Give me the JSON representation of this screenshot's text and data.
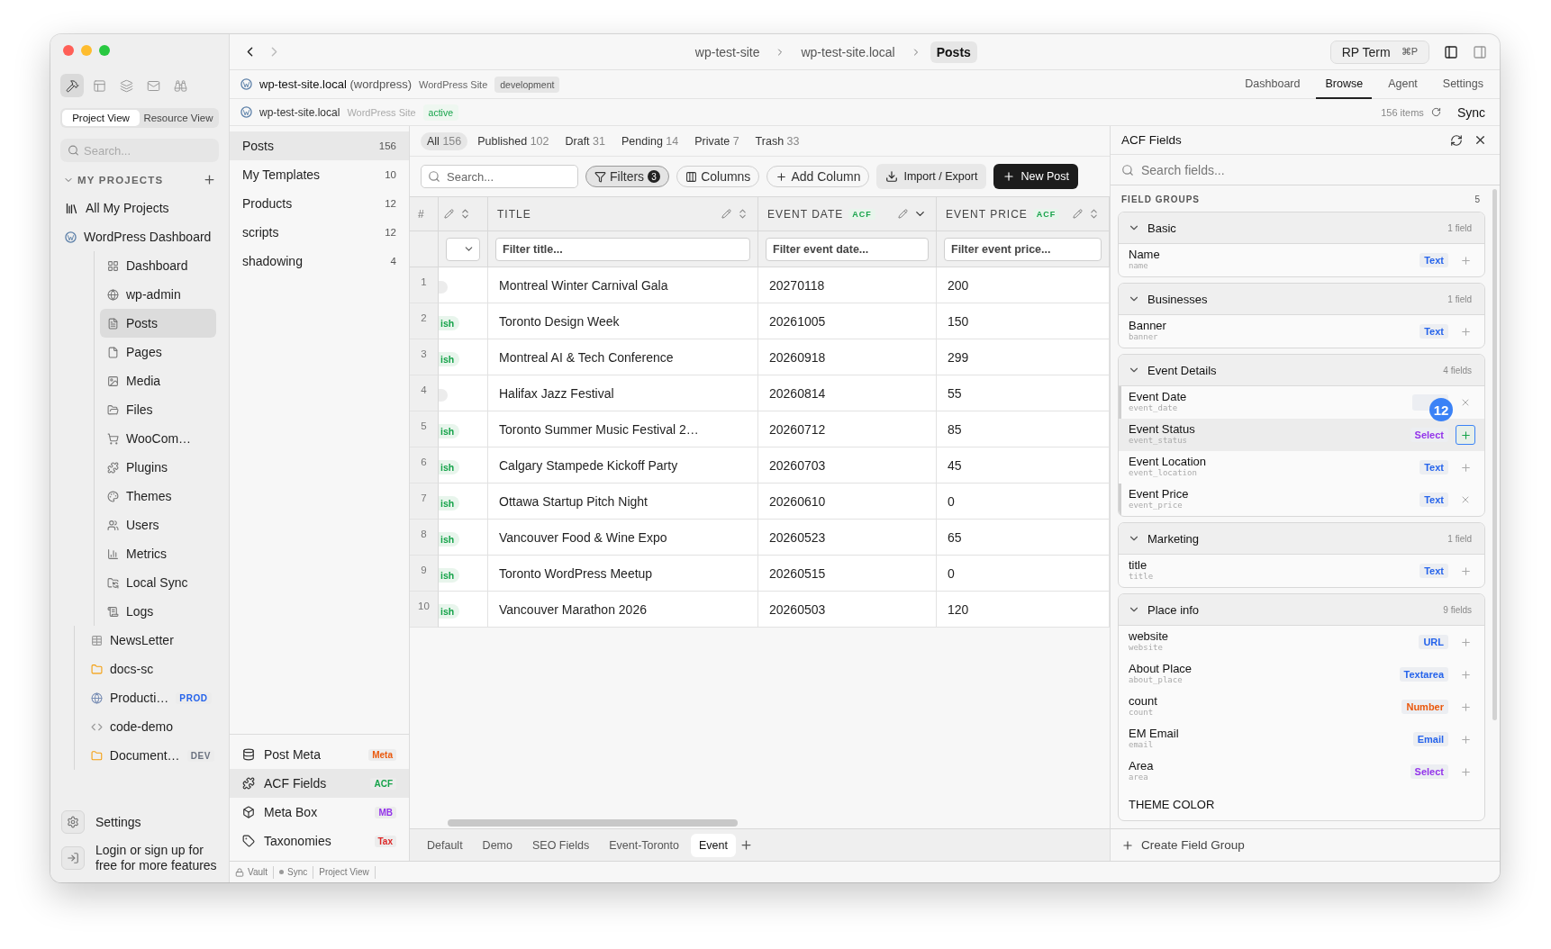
{
  "sidebar": {
    "tools": [
      {
        "selected": true
      },
      {
        "selected": false
      },
      {
        "selected": false
      },
      {
        "selected": false
      },
      {
        "selected": false
      }
    ],
    "view_tabs": [
      {
        "label": "Project View",
        "selected": true
      },
      {
        "label": "Resource View",
        "selected": false
      }
    ],
    "search": {
      "placeholder": "Search..."
    },
    "section": "MY PROJECTS",
    "items": [
      {
        "label": "All My Projects",
        "kind": "root",
        "selected": false
      },
      {
        "label": "WordPress Dashboard",
        "kind": "root",
        "selected": false,
        "children": [
          {
            "label": "Dashboard",
            "selected": false
          },
          {
            "label": "wp-admin",
            "selected": false
          },
          {
            "label": "Posts",
            "selected": true
          },
          {
            "label": "Pages",
            "selected": false
          },
          {
            "label": "Media",
            "selected": false
          },
          {
            "label": "Files",
            "selected": false
          },
          {
            "label": "WooCom…",
            "selected": false
          },
          {
            "label": "Plugins",
            "selected": false
          },
          {
            "label": "Themes",
            "selected": false
          },
          {
            "label": "Users",
            "selected": false
          },
          {
            "label": "Metrics",
            "selected": false
          },
          {
            "label": "Local Sync",
            "selected": false
          },
          {
            "label": "Logs",
            "selected": false
          }
        ]
      },
      {
        "label": "NewsLetter",
        "kind": "project",
        "selected": false
      },
      {
        "label": "docs-sc",
        "kind": "project",
        "selected": false
      },
      {
        "label": "Producti…",
        "kind": "project",
        "selected": false,
        "badge": "PROD",
        "color": "#2563eb"
      },
      {
        "label": "code-demo",
        "kind": "project",
        "selected": false
      },
      {
        "label": "Document…",
        "kind": "project",
        "selected": false,
        "badge": "DEV",
        "color": "#6b7280"
      }
    ],
    "settings": "Settings",
    "login": "Login or sign up for free for more features"
  },
  "topbar": {
    "breadcrumbs": [
      {
        "label": "wp-test-site",
        "selected": false
      },
      {
        "label": "wp-test-site.local",
        "selected": false
      },
      {
        "label": "Posts",
        "selected": true
      }
    ],
    "term_button": {
      "label": "RP Term",
      "shortcut": "⌘P"
    }
  },
  "site": {
    "name": "wp-test-site.local",
    "type_note": "(wordpress)",
    "kind_label": "WordPress Site",
    "env": "development",
    "nav": [
      {
        "label": "Dashboard",
        "selected": false
      },
      {
        "label": "Browse",
        "selected": true
      },
      {
        "label": "Agent",
        "selected": false
      },
      {
        "label": "Settings",
        "selected": false
      }
    ]
  },
  "connection": {
    "name": "wp-test-site.local",
    "kind_label": "WordPress Site",
    "status": "active",
    "items": "156 items",
    "sync": "Sync"
  },
  "post_types": [
    {
      "label": "Posts",
      "count": "156",
      "selected": true
    },
    {
      "label": "My Templates",
      "count": "10",
      "selected": false
    },
    {
      "label": "Products",
      "count": "12",
      "selected": false
    },
    {
      "label": "scripts",
      "count": "12",
      "selected": false
    },
    {
      "label": "shadowing",
      "count": "4",
      "selected": false
    }
  ],
  "meta_sources": [
    {
      "label": "Post Meta",
      "badge": "Meta",
      "color": "#ea580c",
      "selected": false
    },
    {
      "label": "ACF Fields",
      "badge": "ACF",
      "color": "#16a34a",
      "selected": true
    },
    {
      "label": "Meta Box",
      "badge": "MB",
      "color": "#9333ea",
      "selected": false
    },
    {
      "label": "Taxonomies",
      "badge": "Tax",
      "color": "#dc2626",
      "selected": false
    }
  ],
  "status_tabs": [
    {
      "label": "All",
      "count": "156",
      "selected": true
    },
    {
      "label": "Published",
      "count": "102",
      "selected": false
    },
    {
      "label": "Draft",
      "count": "31",
      "selected": false
    },
    {
      "label": "Pending",
      "count": "14",
      "selected": false
    },
    {
      "label": "Private",
      "count": "7",
      "selected": false
    },
    {
      "label": "Trash",
      "count": "33",
      "selected": false
    }
  ],
  "toolbar": {
    "search": {
      "placeholder": "Search..."
    },
    "filters": {
      "label": "Filters",
      "count": "3",
      "active": true
    },
    "columns": "Columns",
    "add_column": "Add Column",
    "import_export": "Import / Export",
    "new_post": "New Post"
  },
  "table": {
    "columns": [
      {
        "kind": "index",
        "label": "#"
      },
      {
        "kind": "partial"
      },
      {
        "kind": "field",
        "label": "TITLE",
        "placeholder": "Filter title...",
        "sorted": false
      },
      {
        "kind": "field",
        "label": "EVENT DATE",
        "tag": "ACF",
        "placeholder": "Filter event date...",
        "sorted": true
      },
      {
        "kind": "field",
        "label": "EVENT PRICE",
        "tag": "ACF",
        "placeholder": "Filter event price...",
        "sorted": false
      }
    ],
    "rows": [
      {
        "index": "1",
        "badge": {
          "kind": "faded"
        },
        "title": "Montreal Winter Carnival Gala",
        "event_date": "20270118",
        "event_price": "200"
      },
      {
        "index": "2",
        "badge": {
          "kind": "published",
          "text": "ish"
        },
        "title": "Toronto Design Week",
        "event_date": "20261005",
        "event_price": "150"
      },
      {
        "index": "3",
        "badge": {
          "kind": "published",
          "text": "ish"
        },
        "title": "Montreal AI & Tech Conference",
        "event_date": "20260918",
        "event_price": "299"
      },
      {
        "index": "4",
        "badge": {
          "kind": "faded"
        },
        "title": "Halifax Jazz Festival",
        "event_date": "20260814",
        "event_price": "55"
      },
      {
        "index": "5",
        "badge": {
          "kind": "published",
          "text": "ish"
        },
        "title": "Toronto Summer Music Festival 2…",
        "event_date": "20260712",
        "event_price": "85"
      },
      {
        "index": "6",
        "badge": {
          "kind": "published",
          "text": "ish"
        },
        "title": "Calgary Stampede Kickoff Party",
        "event_date": "20260703",
        "event_price": "45"
      },
      {
        "index": "7",
        "badge": {
          "kind": "published",
          "text": "ish"
        },
        "title": "Ottawa Startup Pitch Night",
        "event_date": "20260610",
        "event_price": "0"
      },
      {
        "index": "8",
        "badge": {
          "kind": "published",
          "text": "ish"
        },
        "title": "Vancouver Food & Wine Expo",
        "event_date": "20260523",
        "event_price": "65"
      },
      {
        "index": "9",
        "badge": {
          "kind": "published",
          "text": "ish"
        },
        "title": "Toronto WordPress Meetup",
        "event_date": "20260515",
        "event_price": "0"
      },
      {
        "index": "10",
        "badge": {
          "kind": "published",
          "text": "ish"
        },
        "title": "Vancouver Marathon 2026",
        "event_date": "20260503",
        "event_price": "120"
      }
    ]
  },
  "view_tabs": [
    {
      "label": "Default",
      "selected": false
    },
    {
      "label": "Demo",
      "selected": false
    },
    {
      "label": "SEO Fields",
      "selected": false
    },
    {
      "label": "Event-Toronto",
      "selected": false
    },
    {
      "label": "Event",
      "selected": true
    }
  ],
  "acf": {
    "title": "ACF Fields",
    "search": {
      "placeholder": "Search fields..."
    },
    "section": "FIELD GROUPS",
    "count": "5",
    "marker": "12",
    "groups": [
      {
        "name": "Basic",
        "count": "1 field",
        "fields": [
          {
            "label": "Name",
            "key": "name",
            "type": "Text",
            "color": "#2563eb",
            "in_table": false,
            "selected": false
          }
        ]
      },
      {
        "name": "Businesses",
        "count": "1 field",
        "fields": [
          {
            "label": "Banner",
            "key": "banner",
            "type": "Text",
            "color": "#2563eb",
            "in_table": false,
            "selected": false
          }
        ]
      },
      {
        "name": "Event Details",
        "count": "4 fields",
        "fields": [
          {
            "label": "Event Date",
            "key": "event_date",
            "in_table": true,
            "selected": false
          },
          {
            "label": "Event Status",
            "key": "event_status",
            "type": "Select",
            "color": "#9333ea",
            "in_table": false,
            "selected": true
          },
          {
            "label": "Event Location",
            "key": "event_location",
            "type": "Text",
            "color": "#2563eb",
            "in_table": false,
            "selected": false
          },
          {
            "label": "Event Price",
            "key": "event_price",
            "type": "Text",
            "color": "#2563eb",
            "in_table": true,
            "selected": false
          }
        ]
      },
      {
        "name": "Marketing",
        "count": "1 field",
        "fields": [
          {
            "label": "title",
            "key": "title",
            "type": "Text",
            "color": "#2563eb",
            "in_table": false,
            "selected": false
          }
        ]
      },
      {
        "name": "Place info",
        "count": "9 fields",
        "fields": [
          {
            "label": "website",
            "key": "website",
            "type": "URL",
            "color": "#2563eb",
            "in_table": false,
            "selected": false
          },
          {
            "label": "About Place",
            "key": "about_place",
            "type": "Textarea",
            "color": "#2563eb",
            "in_table": false,
            "selected": false
          },
          {
            "label": "count",
            "key": "count",
            "type": "Number",
            "color": "#ea580c",
            "in_table": false,
            "selected": false
          },
          {
            "label": "EM Email",
            "key": "email",
            "type": "Email",
            "color": "#2563eb",
            "in_table": false,
            "selected": false
          },
          {
            "label": "Area",
            "key": "area",
            "type": "Select",
            "color": "#9333ea",
            "in_table": false,
            "selected": false
          },
          {
            "label": "THEME COLOR"
          }
        ]
      }
    ],
    "create": "Create Field Group"
  },
  "status_bar": [
    {
      "label": "Vault",
      "kind": "lock"
    },
    {
      "label": "Sync",
      "kind": "dot"
    },
    {
      "label": "Project View",
      "kind": "plain"
    }
  ]
}
